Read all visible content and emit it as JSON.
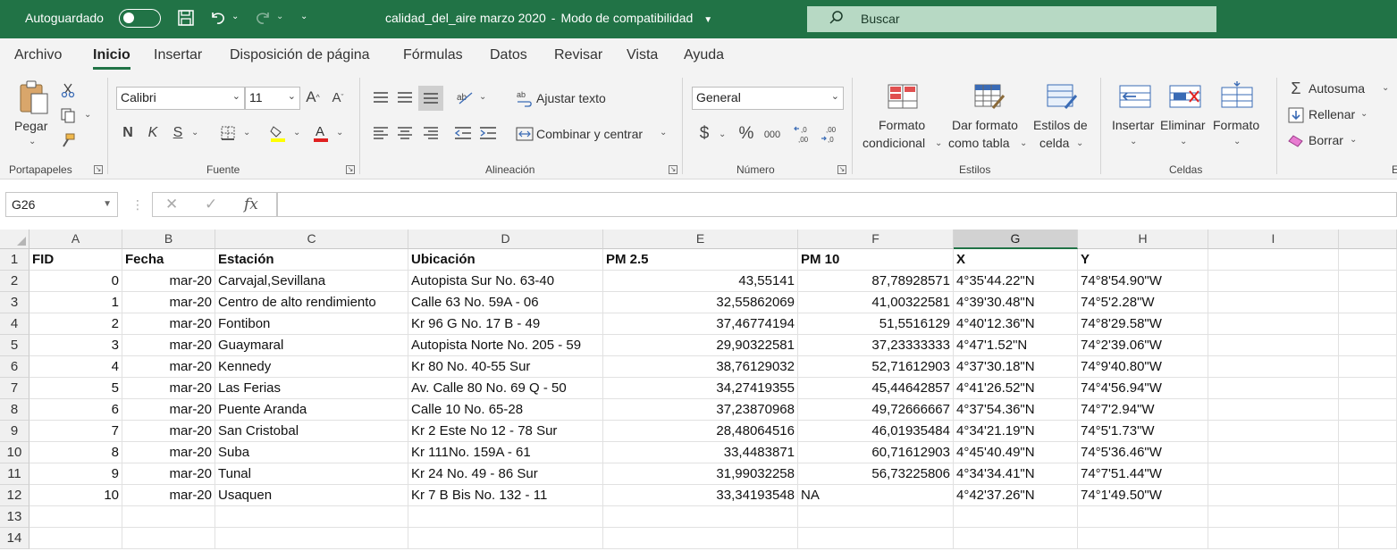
{
  "titlebar": {
    "autosave_label": "Autoguardado",
    "doc_title": "calidad_del_aire marzo 2020",
    "mode": "Modo de compatibilidad",
    "search_placeholder": "Buscar"
  },
  "menu": {
    "tabs": [
      "Archivo",
      "Inicio",
      "Insertar",
      "Disposición de página",
      "Fórmulas",
      "Datos",
      "Revisar",
      "Vista",
      "Ayuda"
    ],
    "active": "Inicio"
  },
  "ribbon": {
    "clipboard": {
      "paste": "Pegar",
      "group": "Portapapeles"
    },
    "font": {
      "name": "Calibri",
      "size": "11",
      "bold": "N",
      "italic": "K",
      "underline": "S",
      "group": "Fuente"
    },
    "alignment": {
      "wrap": "Ajustar texto",
      "merge": "Combinar y centrar",
      "group": "Alineación"
    },
    "number": {
      "format": "General",
      "currency": "$",
      "percent": "%",
      "thousands": "000",
      "dec_inc": ",0 ,00",
      "dec_dec": ",00 ,0",
      "group": "Número"
    },
    "styles": {
      "cond_format_1": "Formato",
      "cond_format_2": "condicional",
      "table_format_1": "Dar formato",
      "table_format_2": "como tabla",
      "cell_styles_1": "Estilos de",
      "cell_styles_2": "celda",
      "group": "Estilos"
    },
    "cells": {
      "insert": "Insertar",
      "delete": "Eliminar",
      "format": "Formato",
      "group": "Celdas"
    },
    "editing": {
      "autosum": "Autosuma",
      "fill": "Rellenar",
      "clear": "Borrar",
      "group_partial": "E"
    }
  },
  "formula_bar": {
    "name_box": "G26",
    "fx": "fx",
    "content": ""
  },
  "sheet": {
    "selected_column": "G",
    "columns": [
      "A",
      "B",
      "C",
      "D",
      "E",
      "F",
      "G",
      "H",
      "I"
    ],
    "rows": [
      [
        "FID",
        "Fecha",
        "Estación",
        "Ubicación",
        "PM 2.5",
        "PM 10",
        "X",
        "Y",
        ""
      ],
      [
        "0",
        "mar-20",
        "Carvajal,Sevillana",
        "Autopista Sur No. 63-40",
        "43,55141",
        "87,78928571",
        "4°35'44.22\"N",
        "74°8'54.90\"W",
        ""
      ],
      [
        "1",
        "mar-20",
        "Centro de alto rendimiento",
        "Calle 63 No. 59A - 06",
        "32,55862069",
        "41,00322581",
        "4°39'30.48\"N",
        "74°5'2.28\"W",
        ""
      ],
      [
        "2",
        "mar-20",
        "Fontibon",
        "Kr 96 G No. 17 B - 49",
        "37,46774194",
        "51,5516129",
        "4°40'12.36\"N",
        "74°8'29.58\"W",
        ""
      ],
      [
        "3",
        "mar-20",
        "Guaymaral",
        "Autopista Norte No. 205 - 59",
        "29,90322581",
        "37,23333333",
        "4°47'1.52\"N",
        "74°2'39.06\"W",
        ""
      ],
      [
        "4",
        "mar-20",
        "Kennedy",
        "Kr 80 No. 40-55 Sur",
        "38,76129032",
        "52,71612903",
        "4°37'30.18\"N",
        "74°9'40.80\"W",
        ""
      ],
      [
        "5",
        "mar-20",
        "Las Ferias",
        "Av. Calle 80 No. 69 Q - 50",
        "34,27419355",
        "45,44642857",
        "4°41'26.52\"N",
        "74°4'56.94\"W",
        ""
      ],
      [
        "6",
        "mar-20",
        "Puente Aranda",
        "Calle 10 No. 65-28",
        "37,23870968",
        "49,72666667",
        "4°37'54.36\"N",
        "74°7'2.94\"W",
        ""
      ],
      [
        "7",
        "mar-20",
        "San Cristobal",
        "Kr 2 Este No 12 - 78 Sur",
        "28,48064516",
        "46,01935484",
        "4°34'21.19\"N",
        "74°5'1.73\"W",
        ""
      ],
      [
        "8",
        "mar-20",
        "Suba",
        "Kr 111No. 159A - 61",
        "33,4483871",
        "60,71612903",
        "4°45'40.49\"N",
        "74°5'36.46\"W",
        ""
      ],
      [
        "9",
        "mar-20",
        "Tunal",
        "Kr 24 No. 49 - 86 Sur",
        "31,99032258",
        "56,73225806",
        "4°34'34.41\"N",
        "74°7'51.44\"W",
        ""
      ],
      [
        "10",
        "mar-20",
        "Usaquen",
        "Kr 7 B Bis No. 132 - 11",
        "33,34193548",
        "NA",
        "4°42'37.26\"N",
        "74°1'49.50\"W",
        ""
      ],
      [
        "",
        "",
        "",
        "",
        "",
        "",
        "",
        "",
        ""
      ],
      [
        "",
        "",
        "",
        "",
        "",
        "",
        "",
        "",
        ""
      ]
    ]
  }
}
